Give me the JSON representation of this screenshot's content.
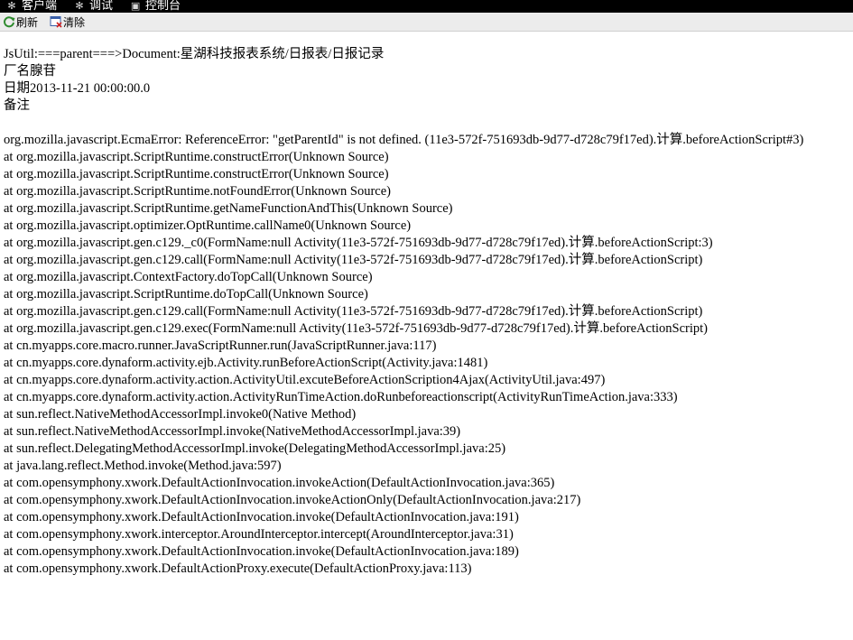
{
  "menubar": {
    "items": [
      {
        "label": "客户端",
        "icon": "gear-icon"
      },
      {
        "label": "调试",
        "icon": "gear-icon"
      },
      {
        "label": "控制台",
        "icon": "console-icon"
      }
    ]
  },
  "toolbar": {
    "refresh_label": "刷新",
    "clear_label": "清除"
  },
  "info": {
    "line1": "JsUtil:===parent===>Document:星湖科技报表系统/日报表/日报记录",
    "line2": "厂名腺苷",
    "line3": "日期2013-11-21 00:00:00.0",
    "line4": "备注"
  },
  "stack_trace": [
    "org.mozilla.javascript.EcmaError: ReferenceError: \"getParentId\" is not defined. (11e3-572f-751693db-9d77-d728c79f17ed).计算.beforeActionScript#3)",
    "at org.mozilla.javascript.ScriptRuntime.constructError(Unknown Source)",
    "at org.mozilla.javascript.ScriptRuntime.constructError(Unknown Source)",
    "at org.mozilla.javascript.ScriptRuntime.notFoundError(Unknown Source)",
    "at org.mozilla.javascript.ScriptRuntime.getNameFunctionAndThis(Unknown Source)",
    "at org.mozilla.javascript.optimizer.OptRuntime.callName0(Unknown Source)",
    "at org.mozilla.javascript.gen.c129._c0(FormName:null Activity(11e3-572f-751693db-9d77-d728c79f17ed).计算.beforeActionScript:3)",
    "at org.mozilla.javascript.gen.c129.call(FormName:null Activity(11e3-572f-751693db-9d77-d728c79f17ed).计算.beforeActionScript)",
    "at org.mozilla.javascript.ContextFactory.doTopCall(Unknown Source)",
    "at org.mozilla.javascript.ScriptRuntime.doTopCall(Unknown Source)",
    "at org.mozilla.javascript.gen.c129.call(FormName:null Activity(11e3-572f-751693db-9d77-d728c79f17ed).计算.beforeActionScript)",
    "at org.mozilla.javascript.gen.c129.exec(FormName:null Activity(11e3-572f-751693db-9d77-d728c79f17ed).计算.beforeActionScript)",
    "at cn.myapps.core.macro.runner.JavaScriptRunner.run(JavaScriptRunner.java:117)",
    "at cn.myapps.core.dynaform.activity.ejb.Activity.runBeforeActionScript(Activity.java:1481)",
    "at cn.myapps.core.dynaform.activity.action.ActivityUtil.excuteBeforeActionScription4Ajax(ActivityUtil.java:497)",
    "at cn.myapps.core.dynaform.activity.action.ActivityRunTimeAction.doRunbeforeactionscript(ActivityRunTimeAction.java:333)",
    "at sun.reflect.NativeMethodAccessorImpl.invoke0(Native Method)",
    "at sun.reflect.NativeMethodAccessorImpl.invoke(NativeMethodAccessorImpl.java:39)",
    "at sun.reflect.DelegatingMethodAccessorImpl.invoke(DelegatingMethodAccessorImpl.java:25)",
    "at java.lang.reflect.Method.invoke(Method.java:597)",
    "at com.opensymphony.xwork.DefaultActionInvocation.invokeAction(DefaultActionInvocation.java:365)",
    "at com.opensymphony.xwork.DefaultActionInvocation.invokeActionOnly(DefaultActionInvocation.java:217)",
    "at com.opensymphony.xwork.DefaultActionInvocation.invoke(DefaultActionInvocation.java:191)",
    "at com.opensymphony.xwork.interceptor.AroundInterceptor.intercept(AroundInterceptor.java:31)",
    "at com.opensymphony.xwork.DefaultActionInvocation.invoke(DefaultActionInvocation.java:189)",
    "at com.opensymphony.xwork.DefaultActionProxy.execute(DefaultActionProxy.java:113)"
  ]
}
